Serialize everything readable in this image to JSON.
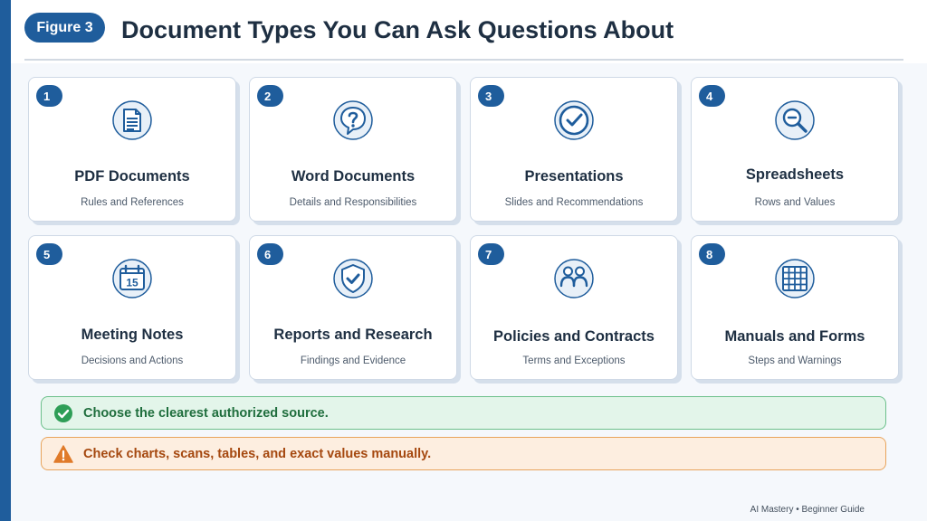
{
  "header": {
    "figure_label": "Figure 3",
    "title": "Document Types You Can Ask Questions About"
  },
  "cards": [
    {
      "number": "1",
      "title": "PDF Documents",
      "subtitle": "Rules and References",
      "icon": "pdf-document-icon"
    },
    {
      "number": "2",
      "title": "Word Documents",
      "subtitle": "Details and Responsibilities",
      "icon": "question-bubble-icon"
    },
    {
      "number": "3",
      "title": "Presentations",
      "subtitle": "Slides and Recommendations",
      "icon": "check-circle-icon"
    },
    {
      "number": "4",
      "title": "Spreadsheets",
      "subtitle": "Rows and Values",
      "icon": "magnifier-icon"
    },
    {
      "number": "5",
      "title": "Meeting Notes",
      "subtitle": "Decisions and Actions",
      "icon": "calendar-icon",
      "icon_text": "15"
    },
    {
      "number": "6",
      "title": "Reports and Research",
      "subtitle": "Findings and Evidence",
      "icon": "shield-check-icon"
    },
    {
      "number": "7",
      "title": "Policies and Contracts",
      "subtitle": "Terms and Exceptions",
      "icon": "people-icon"
    },
    {
      "number": "8",
      "title": "Manuals and Forms",
      "subtitle": "Steps and Warnings",
      "icon": "grid-table-icon"
    }
  ],
  "notes": {
    "good": "Choose the clearest authorized source.",
    "warn": "Check charts, scans, tables, and exact values manually."
  },
  "footer": "AI Mastery • Beginner Guide",
  "colors": {
    "primary": "#1f5d9c",
    "good": "#2e9e57",
    "warn": "#e07b2a"
  }
}
